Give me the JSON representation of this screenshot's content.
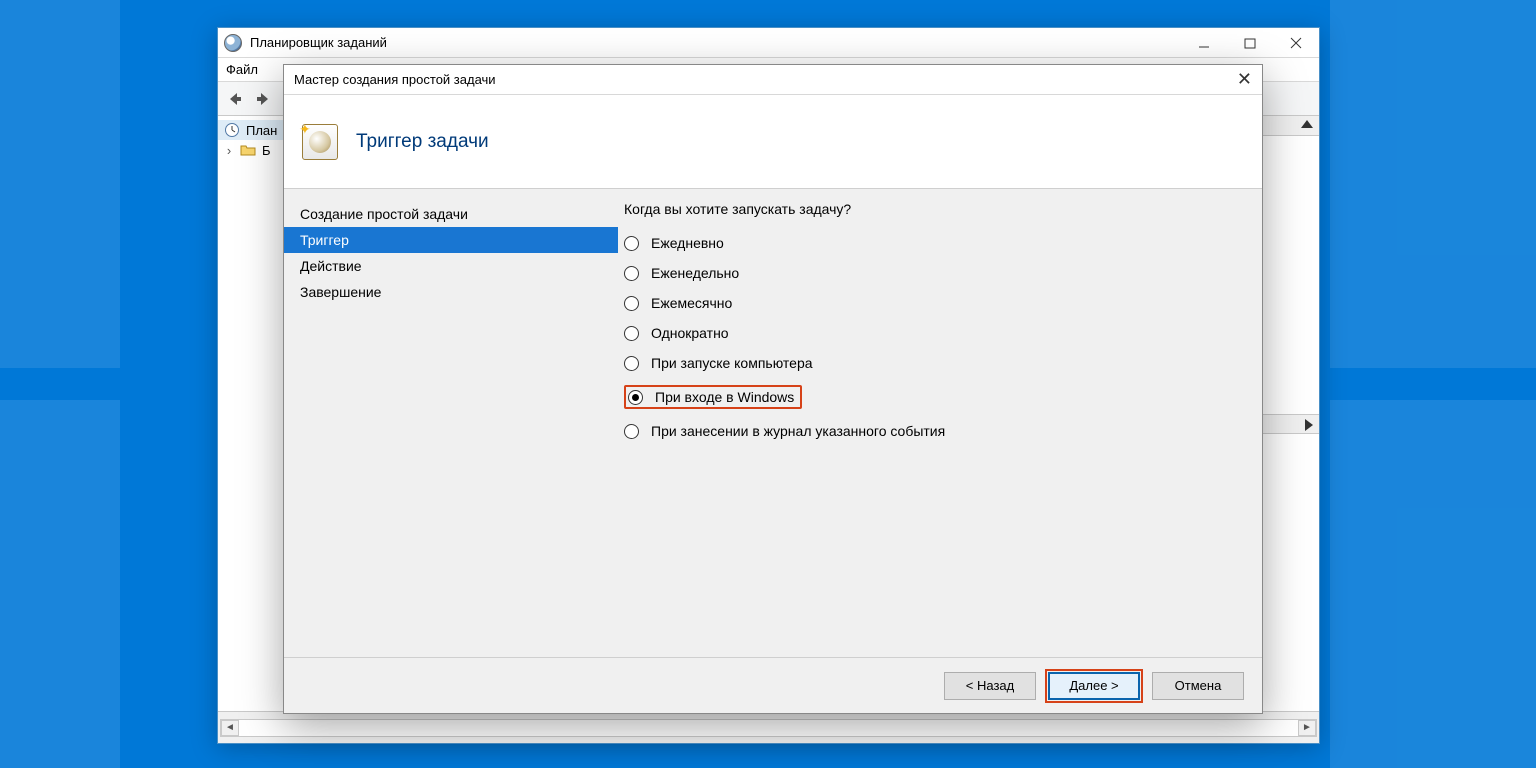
{
  "desktop": {
    "accent": "#0078d7"
  },
  "parent": {
    "title": "Планировщик заданий",
    "menu": {
      "file": "Файл"
    },
    "tree": {
      "root": "План",
      "child_prefix": "Б"
    }
  },
  "wizard": {
    "title": "Мастер создания простой задачи",
    "header": "Триггер задачи",
    "nav": {
      "create": "Создание простой задачи",
      "trigger": "Триггер",
      "action": "Действие",
      "finish": "Завершение"
    },
    "prompt": "Когда вы хотите запускать задачу?",
    "options": {
      "daily": "Ежедневно",
      "weekly": "Еженедельно",
      "monthly": "Ежемесячно",
      "once": "Однократно",
      "startup": "При запуске компьютера",
      "logon": "При входе в Windows",
      "event": "При занесении в журнал указанного события"
    },
    "selected": "logon",
    "buttons": {
      "back": "< Назад",
      "next": "Далее >",
      "cancel": "Отмена"
    }
  }
}
